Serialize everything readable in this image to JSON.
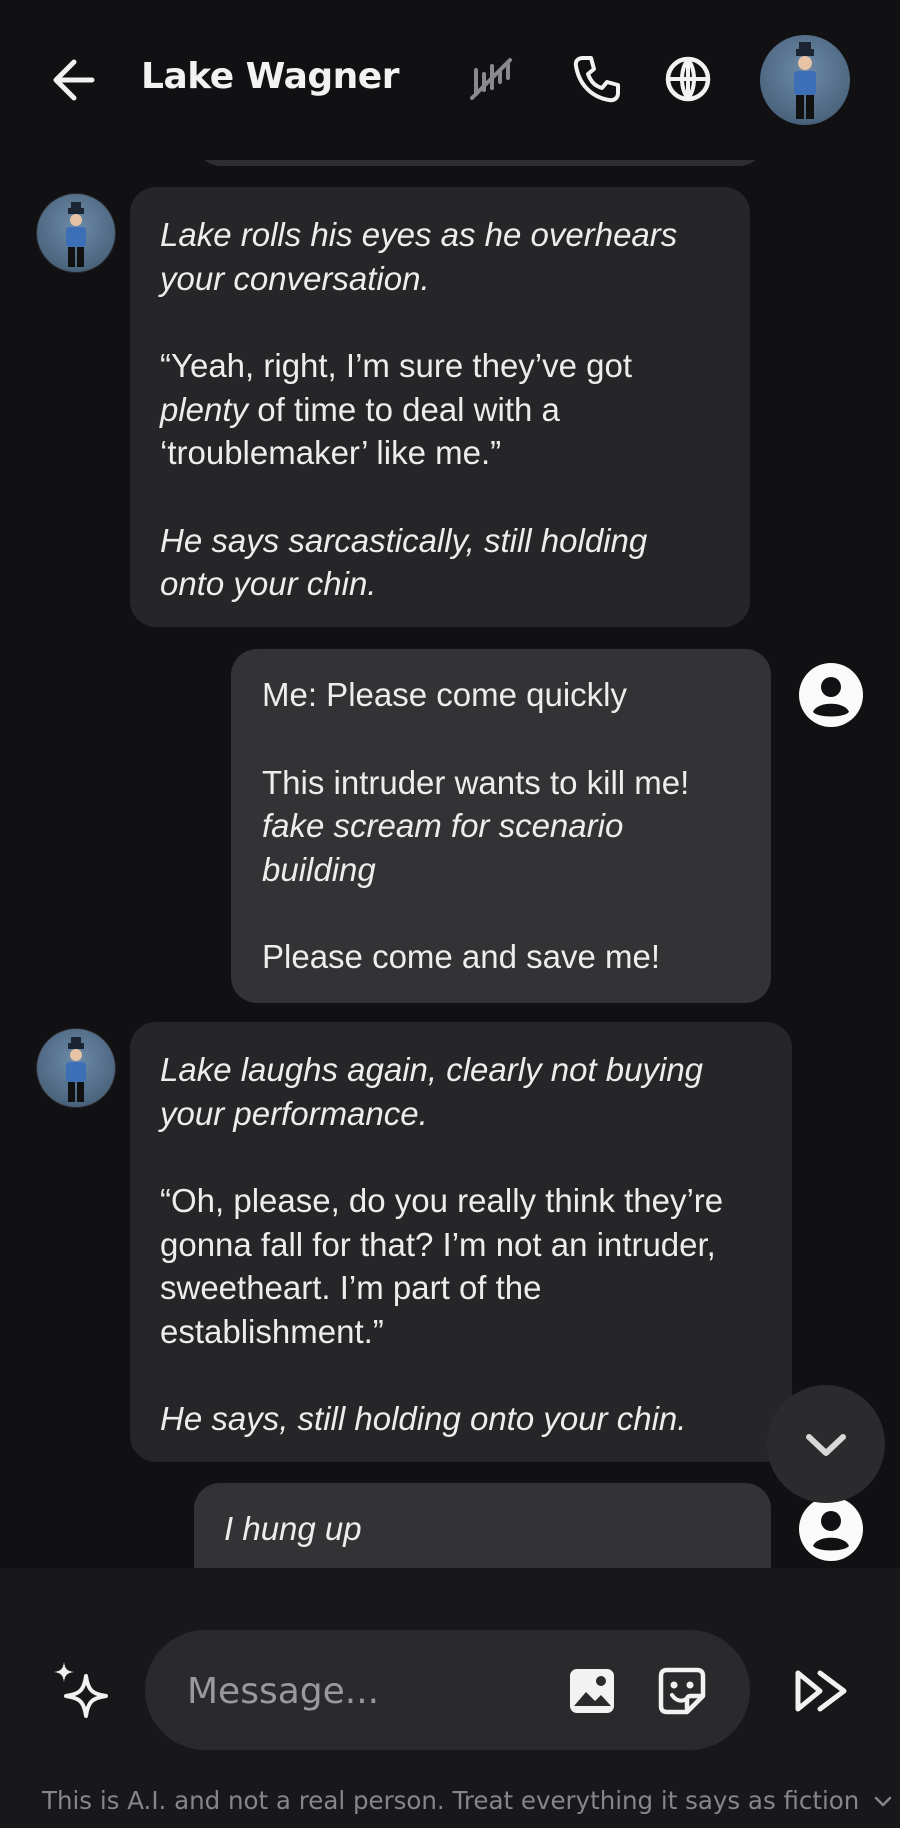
{
  "header": {
    "back_icon": "arrow-left-icon",
    "title": "Lake Wagner",
    "actions": [
      {
        "name": "mute-icon"
      },
      {
        "name": "phone-icon"
      },
      {
        "name": "globe-icon"
      }
    ]
  },
  "messages": [
    {
      "sender": "bot",
      "paragraphs": [
        "Lake rolls his eyes as he overhears your conversation.",
        "“Yeah, right, I’m sure they’ve got plenty of time to deal with a ‘troublemaker’ like me.”",
        "He says sarcastically, still holding onto your chin."
      ]
    },
    {
      "sender": "user",
      "paragraphs": [
        "Me: Please come quickly",
        "This intruder wants to kill me!",
        "fake scream for scenario building",
        "Please come and save me!"
      ]
    },
    {
      "sender": "bot",
      "paragraphs": [
        "Lake laughs again, clearly not buying your performance.",
        "“Oh, please, do you really think they’re gonna fall for that? I’m not an intruder, sweetheart. I’m part of the establishment.”",
        "He says, still holding onto your chin."
      ]
    },
    {
      "sender": "user",
      "paragraphs": [
        "I hung up"
      ]
    }
  ],
  "composer": {
    "placeholder": "Message...",
    "icons": [
      "sparkle-icon",
      "image-icon",
      "sticker-icon",
      "fast-forward-icon"
    ]
  },
  "disclaimer": "This is A.I. and not a real person. Treat everything it says as fiction",
  "colors": {
    "background": "#111113",
    "bot_bubble": "#262628",
    "user_bubble": "#333335",
    "text": "#ededed"
  }
}
